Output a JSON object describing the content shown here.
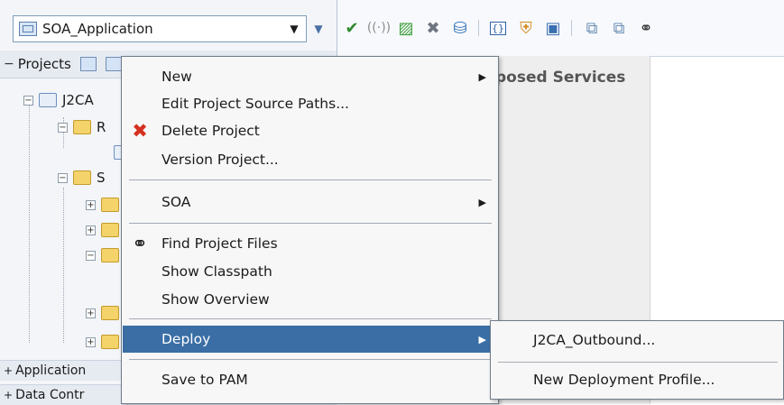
{
  "app_selector": {
    "value": "SOA_Application"
  },
  "navigator": {
    "title": "Projects",
    "project_label": "J2CA",
    "folder_r_label": "R",
    "folder_s_label": "S",
    "accordions": [
      "Application",
      "Data Contr"
    ]
  },
  "editor": {
    "exposed_services_label": "posed Services"
  },
  "context_menu": {
    "items": [
      {
        "label": "New",
        "has_submenu": true
      },
      {
        "label": "Edit Project Source Paths...",
        "has_submenu": false
      },
      {
        "label": "Delete Project",
        "has_submenu": false,
        "icon": "delete-icon"
      },
      {
        "label": "Version Project...",
        "has_submenu": false
      },
      {
        "label": "SOA",
        "has_submenu": true
      },
      {
        "label": "Find Project Files",
        "has_submenu": false,
        "icon": "binoculars-icon"
      },
      {
        "label": "Show Classpath",
        "has_submenu": false
      },
      {
        "label": "Show Overview",
        "has_submenu": false
      },
      {
        "label": "Deploy",
        "has_submenu": true,
        "highlighted": true
      },
      {
        "label": "Save to PAM",
        "has_submenu": false
      }
    ]
  },
  "deploy_submenu": {
    "items": [
      "J2CA_Outbound...",
      "New Deployment Profile..."
    ]
  },
  "colors": {
    "highlight": "#3a6ea5",
    "menu_bg": "#f7f7f7",
    "nav_bg": "#f3f5f8"
  }
}
